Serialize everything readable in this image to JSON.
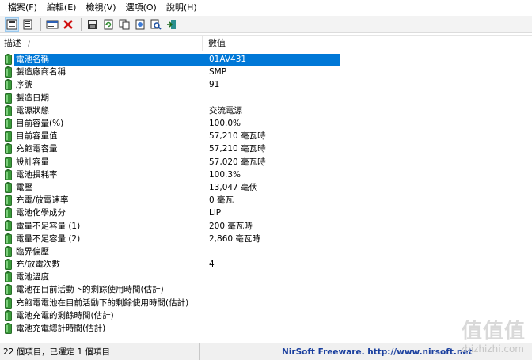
{
  "menu": [
    "檔案(F)",
    "編輯(E)",
    "檢視(V)",
    "選項(O)",
    "說明(H)"
  ],
  "toolbar": {
    "buttons": [
      "view-list-icon",
      "view-report-icon",
      "properties-icon",
      "delete-icon",
      "save-icon",
      "refresh-icon",
      "copy-icon",
      "html-report-icon",
      "find-icon",
      "exit-icon"
    ]
  },
  "list": {
    "headers": {
      "description": "描述",
      "value": "數值",
      "sort": "/"
    },
    "rows": [
      {
        "desc": "電池名稱",
        "val": "01AV431",
        "selected": true
      },
      {
        "desc": "製造廠商名稱",
        "val": "SMP"
      },
      {
        "desc": "序號",
        "val": "  91"
      },
      {
        "desc": "製造日期",
        "val": ""
      },
      {
        "desc": "電源狀態",
        "val": "交流電源"
      },
      {
        "desc": "目前容量(%)",
        "val": "100.0%"
      },
      {
        "desc": "目前容量值",
        "val": "57,210 毫瓦時"
      },
      {
        "desc": "充飽電容量",
        "val": "57,210 毫瓦時"
      },
      {
        "desc": "設計容量",
        "val": "57,020 毫瓦時"
      },
      {
        "desc": "電池損耗率",
        "val": "100.3%"
      },
      {
        "desc": "電壓",
        "val": "13,047 毫伏"
      },
      {
        "desc": "充電/放電速率",
        "val": "0 毫瓦"
      },
      {
        "desc": "電池化學成分",
        "val": "LiP"
      },
      {
        "desc": "電量不足容量 (1)",
        "val": "200 毫瓦時"
      },
      {
        "desc": "電量不足容量 (2)",
        "val": "2,860 毫瓦時"
      },
      {
        "desc": "臨界偏壓",
        "val": ""
      },
      {
        "desc": "充/放電次數",
        "val": "4"
      },
      {
        "desc": "電池溫度",
        "val": ""
      },
      {
        "desc": "電池在目前活動下的剩餘使用時間(估計)",
        "val": ""
      },
      {
        "desc": "充飽電電池在目前活動下的剩餘使用時間(估計)",
        "val": ""
      },
      {
        "desc": "電池充電的剩餘時間(估計)",
        "val": ""
      },
      {
        "desc": "電池充電總計時間(估計)",
        "val": ""
      }
    ]
  },
  "status": {
    "left": "22 個項目，已選定 1 個項目",
    "right": "NirSoft Freeware.  http://www.nirsoft.net"
  },
  "watermark": {
    "main": "值值值",
    "sub": "zhizhizhi.com"
  },
  "colors": {
    "selection": "#0078d7",
    "battery_green": "#3a9a3a",
    "link_blue": "#1a3f9e"
  }
}
